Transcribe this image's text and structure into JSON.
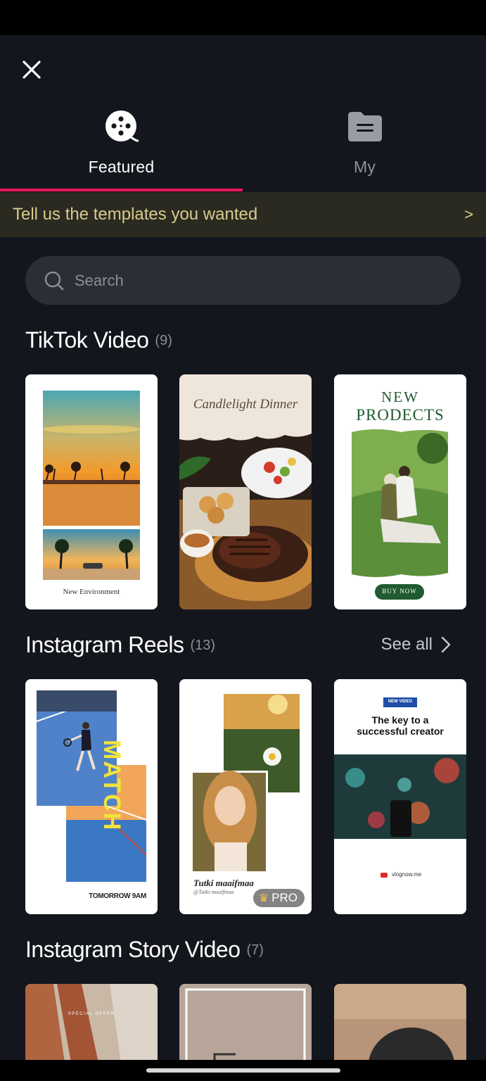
{
  "tabs": [
    {
      "label": "Featured",
      "icon": "film-reel-icon",
      "active": true
    },
    {
      "label": "My",
      "icon": "folder-icon",
      "active": false
    }
  ],
  "accent_color": "#e8175d",
  "banner": {
    "text": "Tell us the templates you wanted",
    "arrow": ">"
  },
  "search": {
    "placeholder": "Search"
  },
  "sections": [
    {
      "title": "TikTok Video",
      "count": "(9)",
      "cards": [
        {
          "caption": "New Environment"
        },
        {
          "caption": "Candlelight Dinner"
        },
        {
          "heading_line1": "NEW",
          "heading_line2": "PRODECTS",
          "button": "BUY NOW"
        }
      ]
    },
    {
      "title": "Instagram Reels",
      "count": "(13)",
      "see_all": "See all",
      "cards": [
        {
          "vertical_text": "MATCH",
          "footer": "TOMORROW 9AM"
        },
        {
          "caption": "Tutki maaifmaa",
          "sub_caption": "@Tutki maaifmaa",
          "badge": "PRO"
        },
        {
          "tag": "NEW VIDEO",
          "headline": "The key to a successful creator",
          "footer": "vlognow.me"
        }
      ]
    },
    {
      "title": "Instagram Story Video",
      "count": "(7)",
      "cards": [
        {
          "caption": "SPECIAL OFFER"
        },
        {},
        {}
      ]
    }
  ]
}
